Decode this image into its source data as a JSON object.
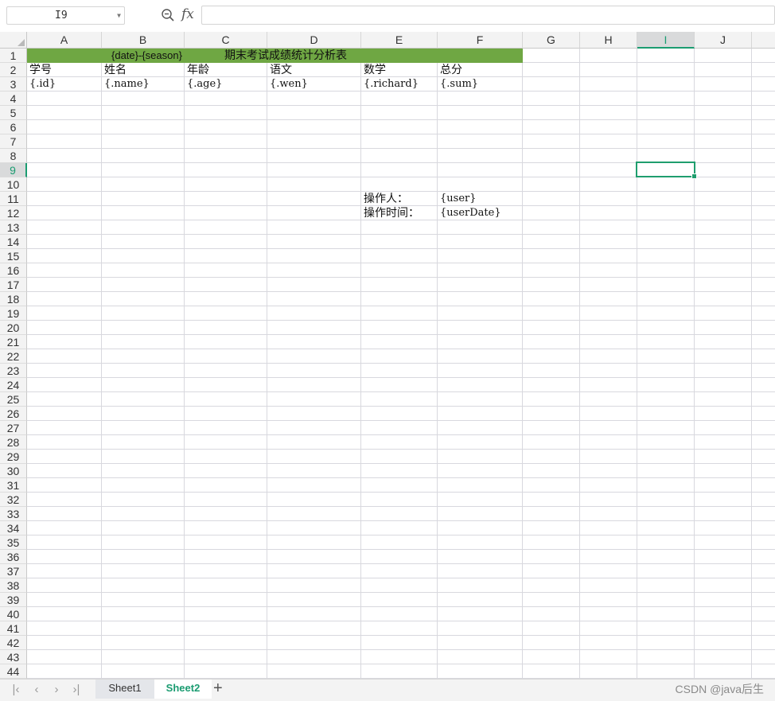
{
  "formula_bar": {
    "name_box": "I9",
    "fx_label": "fx",
    "formula_value": ""
  },
  "columns": [
    "A",
    "B",
    "C",
    "D",
    "E",
    "F",
    "G",
    "H",
    "I",
    "J"
  ],
  "selected_column": "I",
  "rows": [
    "1",
    "2",
    "3",
    "4",
    "5",
    "6",
    "7",
    "8",
    "9",
    "10",
    "11",
    "12",
    "13",
    "14",
    "15",
    "16",
    "17",
    "18",
    "19",
    "20",
    "21",
    "22",
    "23",
    "24",
    "25",
    "26",
    "27",
    "28",
    "29",
    "30",
    "31",
    "32",
    "33",
    "34",
    "35",
    "36",
    "37",
    "38",
    "39",
    "40",
    "41",
    "42",
    "43",
    "44"
  ],
  "selected_row": "9",
  "cells": {
    "title_left": "{date}-{season}",
    "title_right": "期末考试成绩统计分析表",
    "A2": "学号",
    "B2": "姓名",
    "C2": "年龄",
    "D2": "语文",
    "E2": "数学",
    "F2": "总分",
    "A3": "{.id}",
    "B3": "{.name}",
    "C3": "{.age}",
    "D3": "{.wen}",
    "E3": "{.richard}",
    "F3": "{.sum}",
    "E11": "操作人：",
    "F11": "{user}",
    "E12": "操作时间：",
    "F12": "{userDate}"
  },
  "colors": {
    "title_fill": "#6fa743",
    "accent": "#1b9c71"
  },
  "sheet_tabs": [
    {
      "label": "Sheet1",
      "active": false
    },
    {
      "label": "Sheet2",
      "active": true
    }
  ],
  "watermark": "CSDN @java后生"
}
